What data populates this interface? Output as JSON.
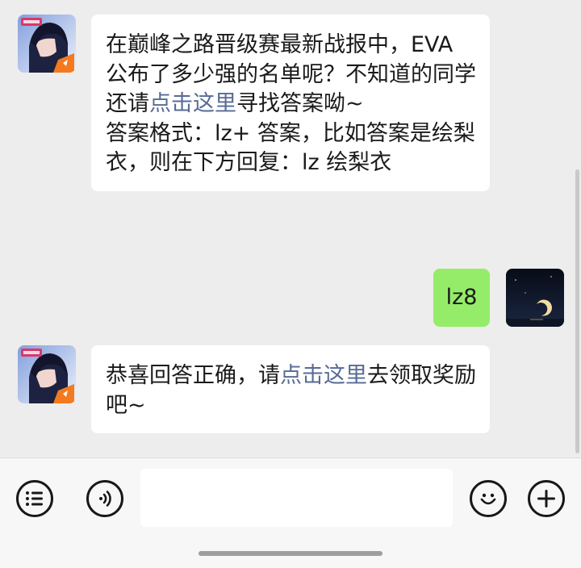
{
  "messages": [
    {
      "sender": "official-account",
      "avatar_icon": "game-character-avatar",
      "paragraphs": [
        {
          "before": "在巅峰之路晋级赛最新战报中，EVA 公布了多少强的名单呢？不知道的同学还请",
          "link": "点击这里",
          "after": "寻找答案呦~"
        },
        {
          "text": "答案格式：lz+ 答案，比如答案是绘梨衣，则在下方回复：lz 绘梨衣"
        }
      ]
    },
    {
      "sender": "me",
      "avatar_icon": "night-sky-moon-avatar",
      "text": "lz8"
    },
    {
      "sender": "official-account",
      "avatar_icon": "game-character-avatar",
      "before": "恭喜回答正确，请",
      "link": "点击这里",
      "after": "去领取奖励吧~"
    }
  ],
  "input_bar": {
    "left_icons": [
      "list-icon",
      "voice-icon"
    ],
    "right_icons": [
      "emoji-icon",
      "plus-icon"
    ],
    "input_value": ""
  },
  "colors": {
    "background": "#ededed",
    "incoming_bubble": "#ffffff",
    "outgoing_bubble": "#95ec69",
    "link": "#576b95",
    "input_bar": "#f7f7f7"
  }
}
